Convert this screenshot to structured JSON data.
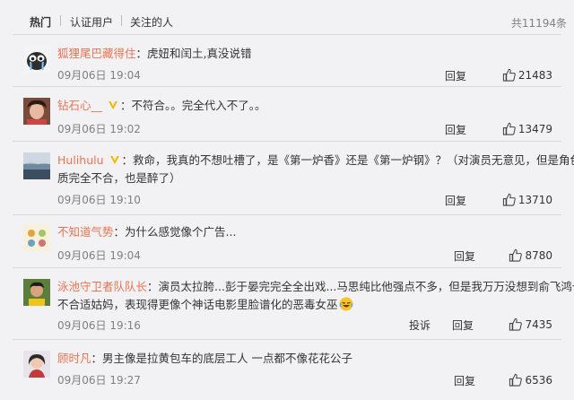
{
  "tabs": {
    "hot": "热门",
    "verified": "认证用户",
    "following": "关注的人",
    "total": "共11194条"
  },
  "comments": [
    {
      "name": "狐狸尾巴藏得住",
      "sep": "：",
      "text": "虎妞和闰土,真没说错",
      "time": "09月06日 19:04",
      "reply": "回复",
      "likes": "21483"
    },
    {
      "name": "钻石心__",
      "sep": "：",
      "text": "不符合。。完全代入不了。。",
      "time": "09月06日 19:02",
      "reply": "回复",
      "likes": "13479"
    },
    {
      "name": "Hulihulu",
      "sep": "：",
      "text": "救命，我真的不想吐槽了，是《第一炉香》还是《第一炉钢》？（对演员无意见，但是角色气",
      "text2": "质完全不合，也是醉了）",
      "time": "09月06日 19:10",
      "reply": "回复",
      "likes": "13710"
    },
    {
      "name": "不知道气势",
      "sep": "：",
      "text": "为什么感觉像个广告...",
      "time": "09月06日 19:04",
      "reply": "回复",
      "likes": "8780"
    },
    {
      "name": "泳池守卫者队队长",
      "sep": "：",
      "text": "演员太拉胯...彭于晏完完全全出戏...马思纯比他强点不多，但是我万万没想到俞飞鸿也",
      "text2": "不合适姑妈，表现得更像个神话电影里脸谱化的恶毒女巫",
      "time": "09月06日 19:16",
      "report": "投诉",
      "reply": "回复",
      "likes": "7435"
    },
    {
      "name": "顾时凡",
      "sep": "：",
      "text": "男主像是拉黄包车的底层工人 一点都不像花花公子",
      "time": "09月06日 19:27",
      "reply": "回复",
      "likes": "6536"
    }
  ],
  "colors": {
    "name": "#eb7350",
    "meta": "#808080",
    "divider": "#d9d9d9",
    "background": "#f2f2f5",
    "verified_badge": "#f5b800"
  }
}
